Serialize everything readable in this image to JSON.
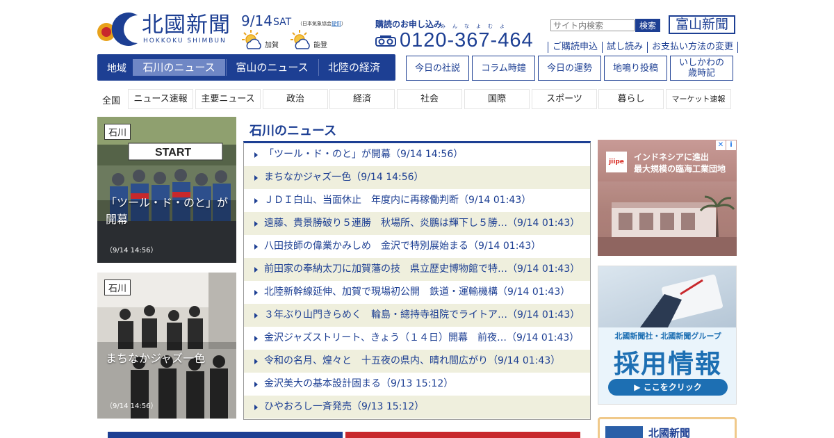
{
  "header": {
    "logo_name_ja": "北國新聞",
    "logo_name_en": "HOKKOKU SHIMBUN",
    "date": "9/14",
    "day": "SAT",
    "weather_note_prefix": "（日本気象協会",
    "weather_note_link": "提供",
    "weather_note_suffix": "）",
    "weather": [
      {
        "place": "加賀",
        "icon": "sun-cloud-icon"
      },
      {
        "place": "能登",
        "icon": "sun-cloud-icon"
      }
    ],
    "subscription_title": "購読のお申し込み",
    "subscription_ruby": "みんなよむよ",
    "phone_number": "0120-367-464",
    "search_placeholder": "サイト内検索",
    "search_button": "検索",
    "toyama_button": "富山新聞",
    "util_links": [
      "ご購読申込",
      "試し読み",
      "お支払い方法の変更"
    ]
  },
  "region_bar": {
    "label": "地域",
    "tabs": [
      "石川のニュース",
      "富山のニュース",
      "北陸の経済"
    ],
    "active_index": 0
  },
  "column_buttons": [
    "今日の社説",
    "コラム時鐘",
    "今日の運勢",
    "地鳴り投稿",
    "いしかわの\n歳時記"
  ],
  "categories": {
    "all_label": "全国",
    "items": [
      "ニュース速報",
      "主要ニュース",
      "政治",
      "経済",
      "社会",
      "国際",
      "スポーツ",
      "暮らし",
      "マーケット速報"
    ]
  },
  "photo_cards": [
    {
      "tag": "石川",
      "caption": "「ツール・ド・のと」が開幕",
      "time": "（9/14 14:56）"
    },
    {
      "tag": "石川",
      "caption": "まちなかジャズ一色",
      "time": "（9/14 14:56）"
    }
  ],
  "news": {
    "heading": "石川のニュース",
    "items": [
      "「ツール・ド・のと」が開幕（9/14 14:56）",
      "まちなかジャズ一色（9/14 14:56）",
      "ＪＤＩ白山、当面休止　年度内に再稼働判断（9/14 01:43）",
      "遠藤、貴景勝破り５連勝　秋場所、炎鵬は輝下し５勝…（9/14 01:43）",
      "八田技師の偉業かみしめ　金沢で特別展始まる（9/14 01:43）",
      "前田家の奉納太刀に加賀藩の技　県立歴史博物館で特…（9/14 01:43）",
      "北陸新幹線延伸、加賀で現場初公開　鉄道・運輸機構（9/14 01:43）",
      "３年ぶり山門きらめく　輪島・總持寺祖院でライトア…（9/14 01:43）",
      "金沢ジャズストリート、きょう（１４日）開幕　前夜…（9/14 01:43）",
      "令和の名月、煌々と　十五夜の県内、晴れ間広がり（9/14 01:43）",
      "金沢美大の基本設計固まる（9/13 15:12）",
      "ひやおろし一斉発売（9/13 15:12）"
    ]
  },
  "ads": {
    "ad1_logo": "jiipe",
    "ad1_line1": "インドネシアに進出",
    "ad1_line2": "最大規模の臨海工業団地",
    "ad2_line1": "北國新聞社・北國新聞グループ",
    "ad2_line2": "採用情報",
    "ad2_button": "▶ ここをクリック",
    "ad3_title": "北國新聞"
  },
  "colors": {
    "brand_blue": "#1d3f93",
    "stripe_beige": "#efefdd",
    "active_tab": "#6f87c5"
  }
}
